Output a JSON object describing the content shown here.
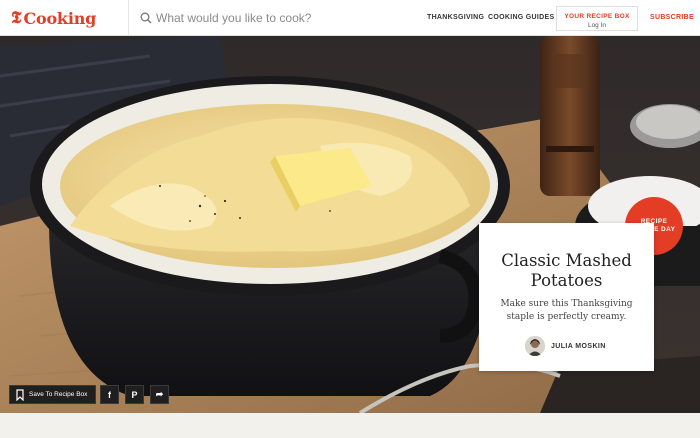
{
  "header": {
    "brand_letter": "𝕿",
    "brand_name": "Cooking",
    "search_placeholder": "What would you like to cook?",
    "nav": [
      "THANKSGIVING",
      "COOKING GUIDES"
    ],
    "recipe_box": {
      "label": "YOUR RECIPE BOX",
      "sub": "Log In"
    },
    "subscribe": "SUBSCRIBE"
  },
  "hero": {
    "badge": {
      "line1": "RECIPE",
      "line2": "OF THE DAY"
    },
    "title": "Classic Mashed Potatoes",
    "description": "Make sure this Thanksgiving staple is perfectly creamy.",
    "author": "JULIA MOSKIN"
  },
  "actions": {
    "save_label": "Save To Recipe Box",
    "share": {
      "facebook": "f",
      "pinterest": "P",
      "forward": "➦"
    }
  },
  "colors": {
    "brand": "#e33d26",
    "card": "#ffffff",
    "action_bar": "#1f1f1f"
  }
}
